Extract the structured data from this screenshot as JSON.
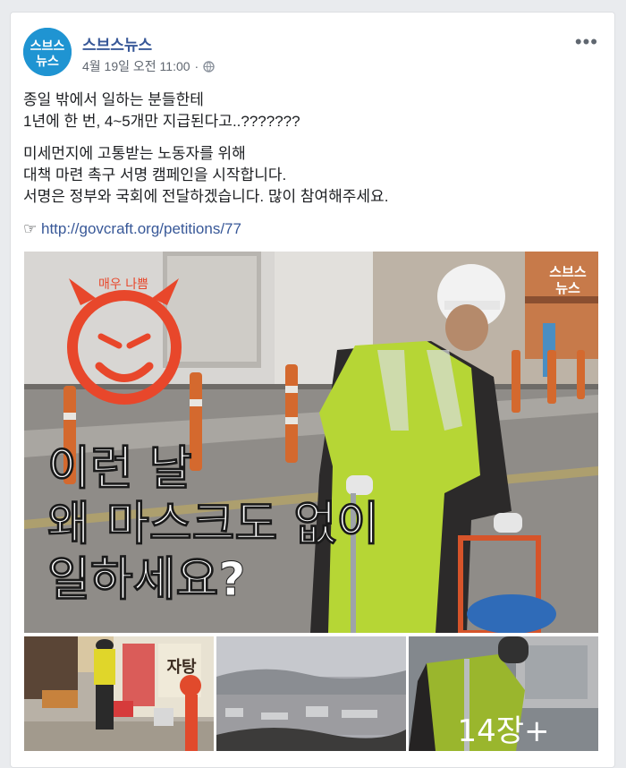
{
  "post": {
    "page_name": "스브스뉴스",
    "timestamp": "4월 19일 오전 11:00",
    "separator": "·",
    "more_label": "•••",
    "body_lines": [
      "종일 밖에서 일하는 분들한테",
      "1년에 한 번, 4~5개만 지급된다고..???????",
      "미세먼지에 고통받는 노동자를 위해",
      "대책 마련 촉구 서명 캠페인을 시작합니다.",
      "서명은 정부와 국회에 전달하겠습니다. 많이 참여해주세요."
    ],
    "link_prefix": "☞",
    "link_url": "http://govcraft.org/petitions/77"
  },
  "logo": {
    "line1": "스브스",
    "line2": "뉴스"
  },
  "hero": {
    "badge": "매우 나쁨",
    "headline_lines": [
      "이런 날",
      "왜 마스크도 없이",
      "일하세요?"
    ],
    "watermark_line1": "스브스",
    "watermark_line2": "뉴스",
    "store_sign": "자탕"
  },
  "thumbnails": {
    "more_count": "14장+"
  },
  "icons": [
    "globe-icon",
    "more-options-icon",
    "devil-face-icon"
  ],
  "colors": {
    "link": "#385898",
    "brand": "#1f94d2",
    "badge": "#e8472b"
  }
}
